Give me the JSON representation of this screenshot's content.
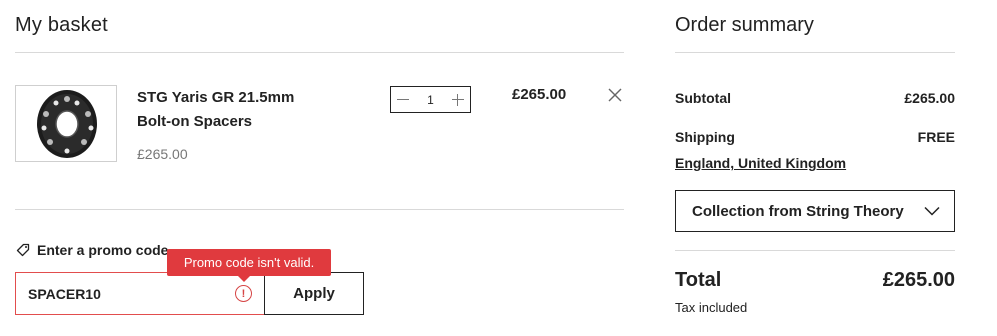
{
  "basket": {
    "title": "My basket",
    "item": {
      "name": "STG Yaris GR 21.5mm Bolt-on Spacers",
      "unit_price": "£265.00",
      "quantity": "1",
      "line_total": "£265.00"
    },
    "promo": {
      "label": "Enter a promo code",
      "value": "SPACER10",
      "apply_label": "Apply",
      "error_message": "Promo code isn't valid.",
      "error_icon": "!"
    }
  },
  "summary": {
    "title": "Order summary",
    "subtotal_label": "Subtotal",
    "subtotal_value": "£265.00",
    "shipping_label": "Shipping",
    "shipping_value": "FREE",
    "shipping_destination": "England, United Kingdom",
    "shipping_method": "Collection from String Theory",
    "total_label": "Total",
    "total_value": "£265.00",
    "tax_note": "Tax included"
  },
  "colors": {
    "error": "#e03a3e",
    "text": "#222222",
    "divider": "#d9d9d9"
  },
  "icons": {
    "tag": "tag-icon",
    "remove": "close-icon",
    "dropdown": "chevron-down-icon",
    "error": "error-circle-icon"
  }
}
